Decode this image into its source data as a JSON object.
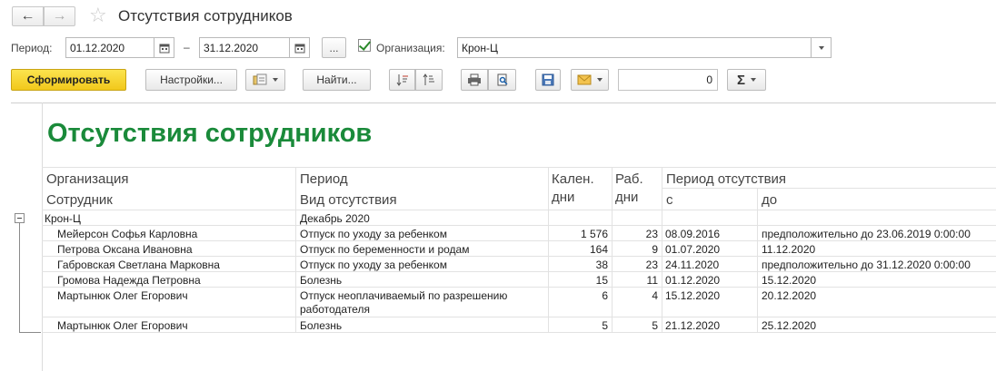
{
  "window": {
    "title": "Отсутствия сотрудников",
    "back_icon": "←",
    "forward_icon": "→",
    "favorite_icon": "☆"
  },
  "filters": {
    "period_label": "Период:",
    "date_from": "01.12.2020",
    "dash": "–",
    "date_to": "31.12.2020",
    "more_label": "...",
    "org_label": "Организация:",
    "org_value": "Крон-Ц",
    "org_checked": true
  },
  "toolbar": {
    "generate_label": "Сформировать",
    "settings_label": "Настройки...",
    "find_label": "Найти...",
    "sum_value": "0",
    "sigma_label": "Σ"
  },
  "report": {
    "title": "Отсутствия сотрудников",
    "headers": {
      "org": "Организация",
      "employee": "Сотрудник",
      "period": "Период",
      "absence_type": "Вид отсутствия",
      "cal_days_1": "Кален.",
      "cal_days_2": "дни",
      "work_days_1": "Раб.",
      "work_days_2": "дни",
      "absence_period": "Период отсутствия",
      "from": "с",
      "to": "до"
    },
    "group": {
      "org": "Крон-Ц",
      "period": "Декабрь 2020"
    },
    "rows": [
      {
        "employee": "Мейерсон Софья Карловна",
        "type": "Отпуск по уходу за ребенком",
        "type2": "",
        "cal": "1 576",
        "work": "23",
        "from": "08.09.2016",
        "to": "предположительно до 23.06.2019 0:00:00"
      },
      {
        "employee": "Петрова Оксана Ивановна",
        "type": "Отпуск по беременности и родам",
        "type2": "",
        "cal": "164",
        "work": "9",
        "from": "01.07.2020",
        "to": "11.12.2020"
      },
      {
        "employee": "Габровская Светлана Марковна",
        "type": "Отпуск по уходу за ребенком",
        "type2": "",
        "cal": "38",
        "work": "23",
        "from": "24.11.2020",
        "to": "предположительно до 31.12.2020 0:00:00"
      },
      {
        "employee": "Громова Надежда Петровна",
        "type": "Болезнь",
        "type2": "",
        "cal": "15",
        "work": "11",
        "from": "01.12.2020",
        "to": "15.12.2020"
      },
      {
        "employee": "Мартынюк Олег Егорович",
        "type": "Отпуск неоплачиваемый по разрешению",
        "type2": "работодателя",
        "cal": "6",
        "work": "4",
        "from": "15.12.2020",
        "to": "20.12.2020"
      },
      {
        "employee": "Мартынюк Олег Егорович",
        "type": "Болезнь",
        "type2": "",
        "cal": "5",
        "work": "5",
        "from": "21.12.2020",
        "to": "25.12.2020"
      }
    ]
  }
}
